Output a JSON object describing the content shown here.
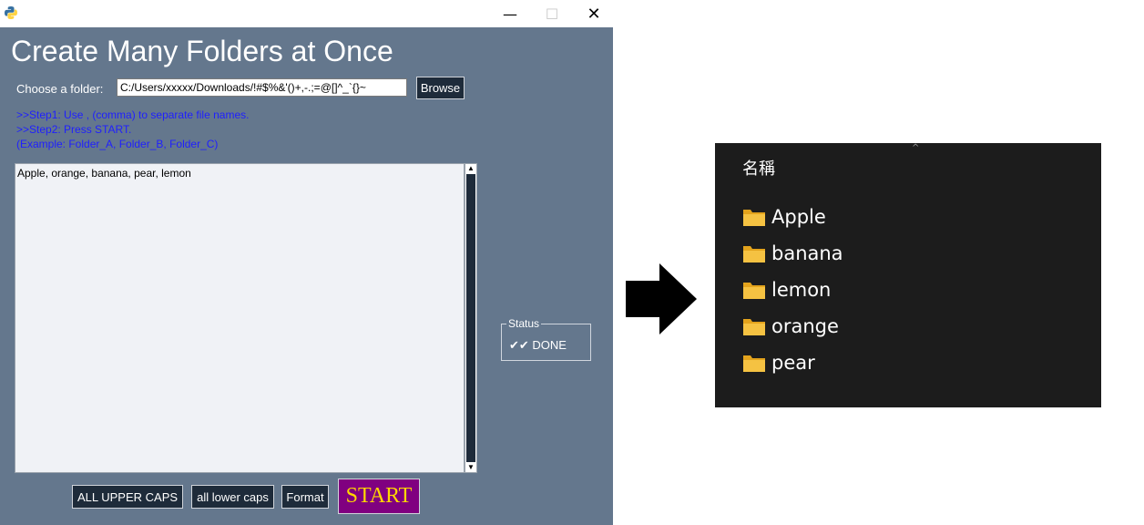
{
  "window": {
    "controls": {
      "minimize": "—",
      "maximize": "☐",
      "close": "✕"
    }
  },
  "main": {
    "title": "Create Many Folders at Once",
    "choose_label": "Choose a folder:",
    "folder_path": "C:/Users/xxxxx/Downloads/!#$%&'()+,-.;=@[]^_`{}~",
    "browse_label": "Browse",
    "instructions": {
      "step1": ">>Step1: Use , (comma) to separate file names.",
      "step2": ">>Step2: Press START.",
      "example": "(Example: Folder_A, Folder_B, Folder_C)"
    },
    "names_text": "Apple, orange, banana, pear, lemon",
    "status": {
      "legend": "Status",
      "text": "✔✔ DONE"
    },
    "buttons": {
      "upper": "ALL UPPER CAPS",
      "lower": "all lower caps",
      "format": "Format",
      "start": "START"
    }
  },
  "explorer": {
    "column_header": "名稱",
    "folders": [
      "Apple",
      "banana",
      "lemon",
      "orange",
      "pear"
    ]
  },
  "colors": {
    "window_bg": "#64778d",
    "button_bg": "#1e2b3a",
    "start_bg": "#800080",
    "start_text": "#ffd700",
    "instruction_text": "#1f1fff",
    "explorer_bg": "#1c1c1c",
    "folder_yellow": "#f5c242"
  },
  "icons": {
    "app": "python-icon",
    "arrow": "right-arrow-icon",
    "folder": "folder-icon"
  }
}
